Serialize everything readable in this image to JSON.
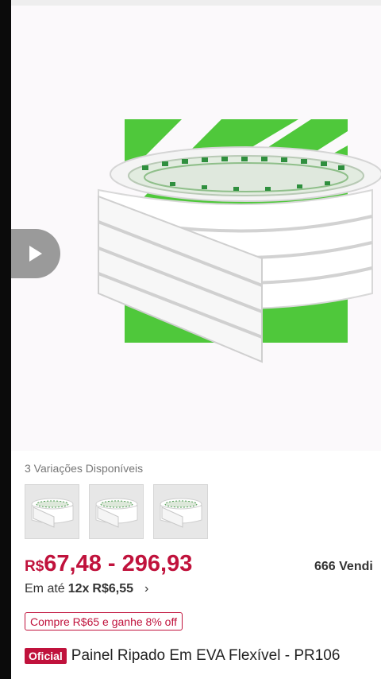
{
  "product": {
    "variations_label": "3 Variações Disponíveis",
    "price_currency": "R$",
    "price_range": "67,48 - 296,93",
    "sold_count": "666 Vendi",
    "installments_prefix": "Em até",
    "installments_count": "12x",
    "installments_value": "R$6,55",
    "promo": "Compre R$65 e ganhe 8% off",
    "badge": "Oficial",
    "title": "Painel Ripado Em EVA Flexível - PR106"
  },
  "icons": {
    "play": "play-icon",
    "chevron": "chevron-right-icon"
  },
  "colors": {
    "accent": "#c0123c",
    "brand_green": "#4fc83b"
  }
}
